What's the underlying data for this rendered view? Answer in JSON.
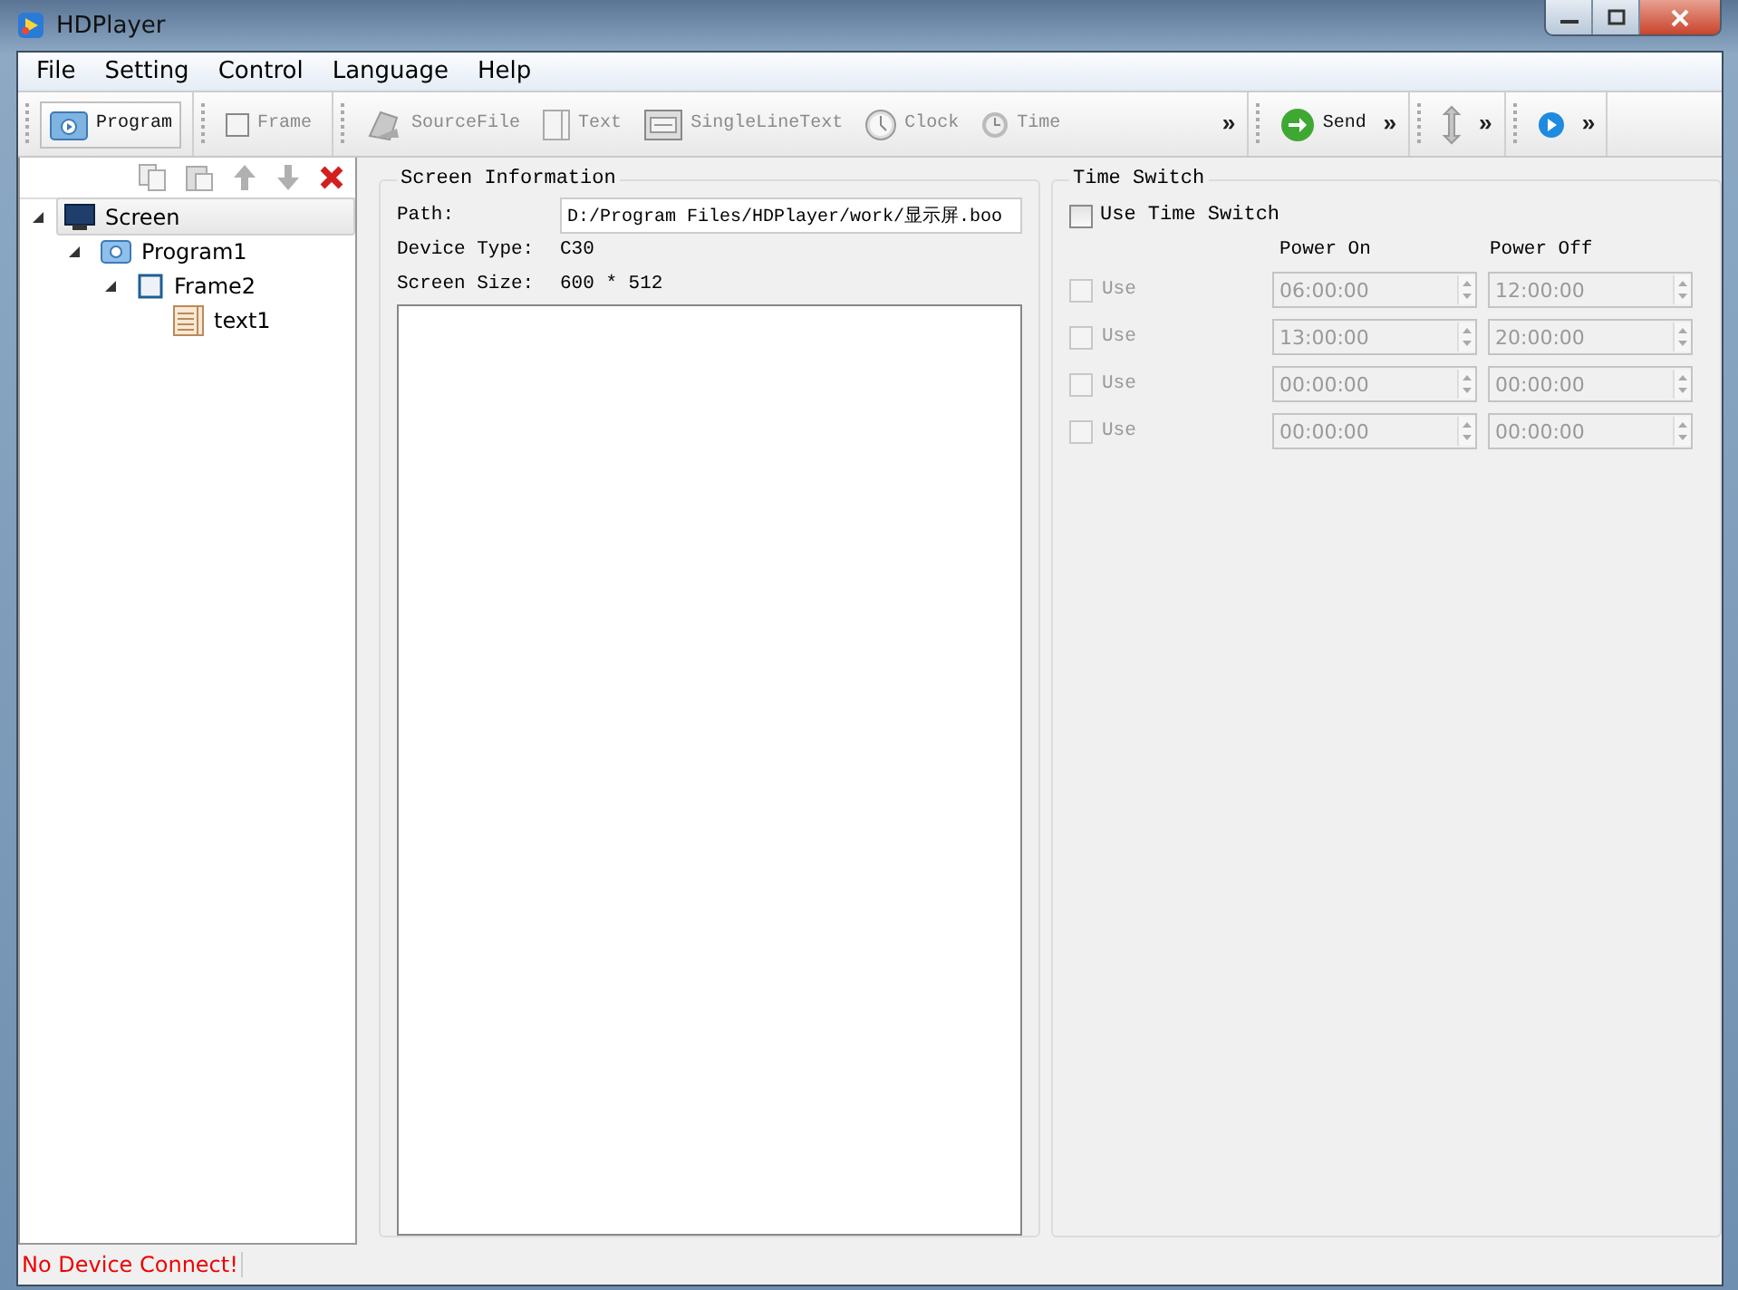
{
  "window": {
    "title": "HDPlayer"
  },
  "menu": [
    "File",
    "Setting",
    "Control",
    "Language",
    "Help"
  ],
  "toolbar": [
    {
      "items": [
        {
          "kind": "program",
          "label": "Program",
          "disabled": false
        }
      ]
    },
    {
      "items": [
        {
          "kind": "frame",
          "label": "Frame",
          "disabled": true
        }
      ]
    },
    {
      "items": [
        {
          "kind": "sourcefile",
          "label": "SourceFile",
          "disabled": true
        },
        {
          "kind": "text",
          "label": "Text",
          "disabled": true
        },
        {
          "kind": "singleline",
          "label": "SingleLineText",
          "disabled": true
        },
        {
          "kind": "clock",
          "label": "Clock",
          "disabled": true
        },
        {
          "kind": "time",
          "label": "Time",
          "disabled": true
        }
      ],
      "overflow": "»"
    },
    {
      "items": [
        {
          "kind": "send",
          "label": "Send",
          "disabled": false
        }
      ],
      "overflow": "»"
    },
    {
      "items": [
        {
          "kind": "updown",
          "disabled": true
        }
      ],
      "overflow": "»"
    },
    {
      "items": [
        {
          "kind": "play",
          "disabled": false
        }
      ],
      "overflow": "»"
    }
  ],
  "tree_tools": [
    {
      "kind": "copy",
      "disabled": true
    },
    {
      "kind": "paste",
      "disabled": true
    },
    {
      "kind": "up",
      "disabled": true
    },
    {
      "kind": "down",
      "disabled": true
    },
    {
      "kind": "delete",
      "disabled": false
    }
  ],
  "tree": [
    {
      "kind": "screen",
      "label": "Screen",
      "selected": true,
      "expanded": true,
      "children": [
        {
          "kind": "program",
          "label": "Program1",
          "selected": false,
          "expanded": true,
          "children": [
            {
              "kind": "frame",
              "label": "Frame2",
              "selected": false,
              "expanded": true,
              "children": [
                {
                  "kind": "text",
                  "label": "text1",
                  "selected": false
                }
              ]
            }
          ]
        }
      ]
    }
  ],
  "screen_information": {
    "title": "Screen Information",
    "path_label": "Path:",
    "path": "D:/Program Files/HDPlayer/work/显示屏.boo",
    "device_type_label": "Device Type:",
    "device_type": "C30",
    "screen_size_label": "Screen Size:",
    "screen_size": "600 * 512"
  },
  "time_switch": {
    "title": "Time Switch",
    "use_label": "Use Time Switch",
    "checked": false,
    "power_on_header": "Power On",
    "power_off_header": "Power Off",
    "rows": [
      {
        "label": "Use",
        "checked": false,
        "disabled": true,
        "power_on": "06:00:00",
        "power_off": "12:00:00"
      },
      {
        "label": "Use",
        "checked": false,
        "disabled": true,
        "power_on": "13:00:00",
        "power_off": "20:00:00"
      },
      {
        "label": "Use",
        "checked": false,
        "disabled": true,
        "power_on": "00:00:00",
        "power_off": "00:00:00"
      },
      {
        "label": "Use",
        "checked": false,
        "disabled": true,
        "power_on": "00:00:00",
        "power_off": "00:00:00"
      }
    ]
  },
  "status_bar": {
    "message": "No Device Connect!"
  }
}
